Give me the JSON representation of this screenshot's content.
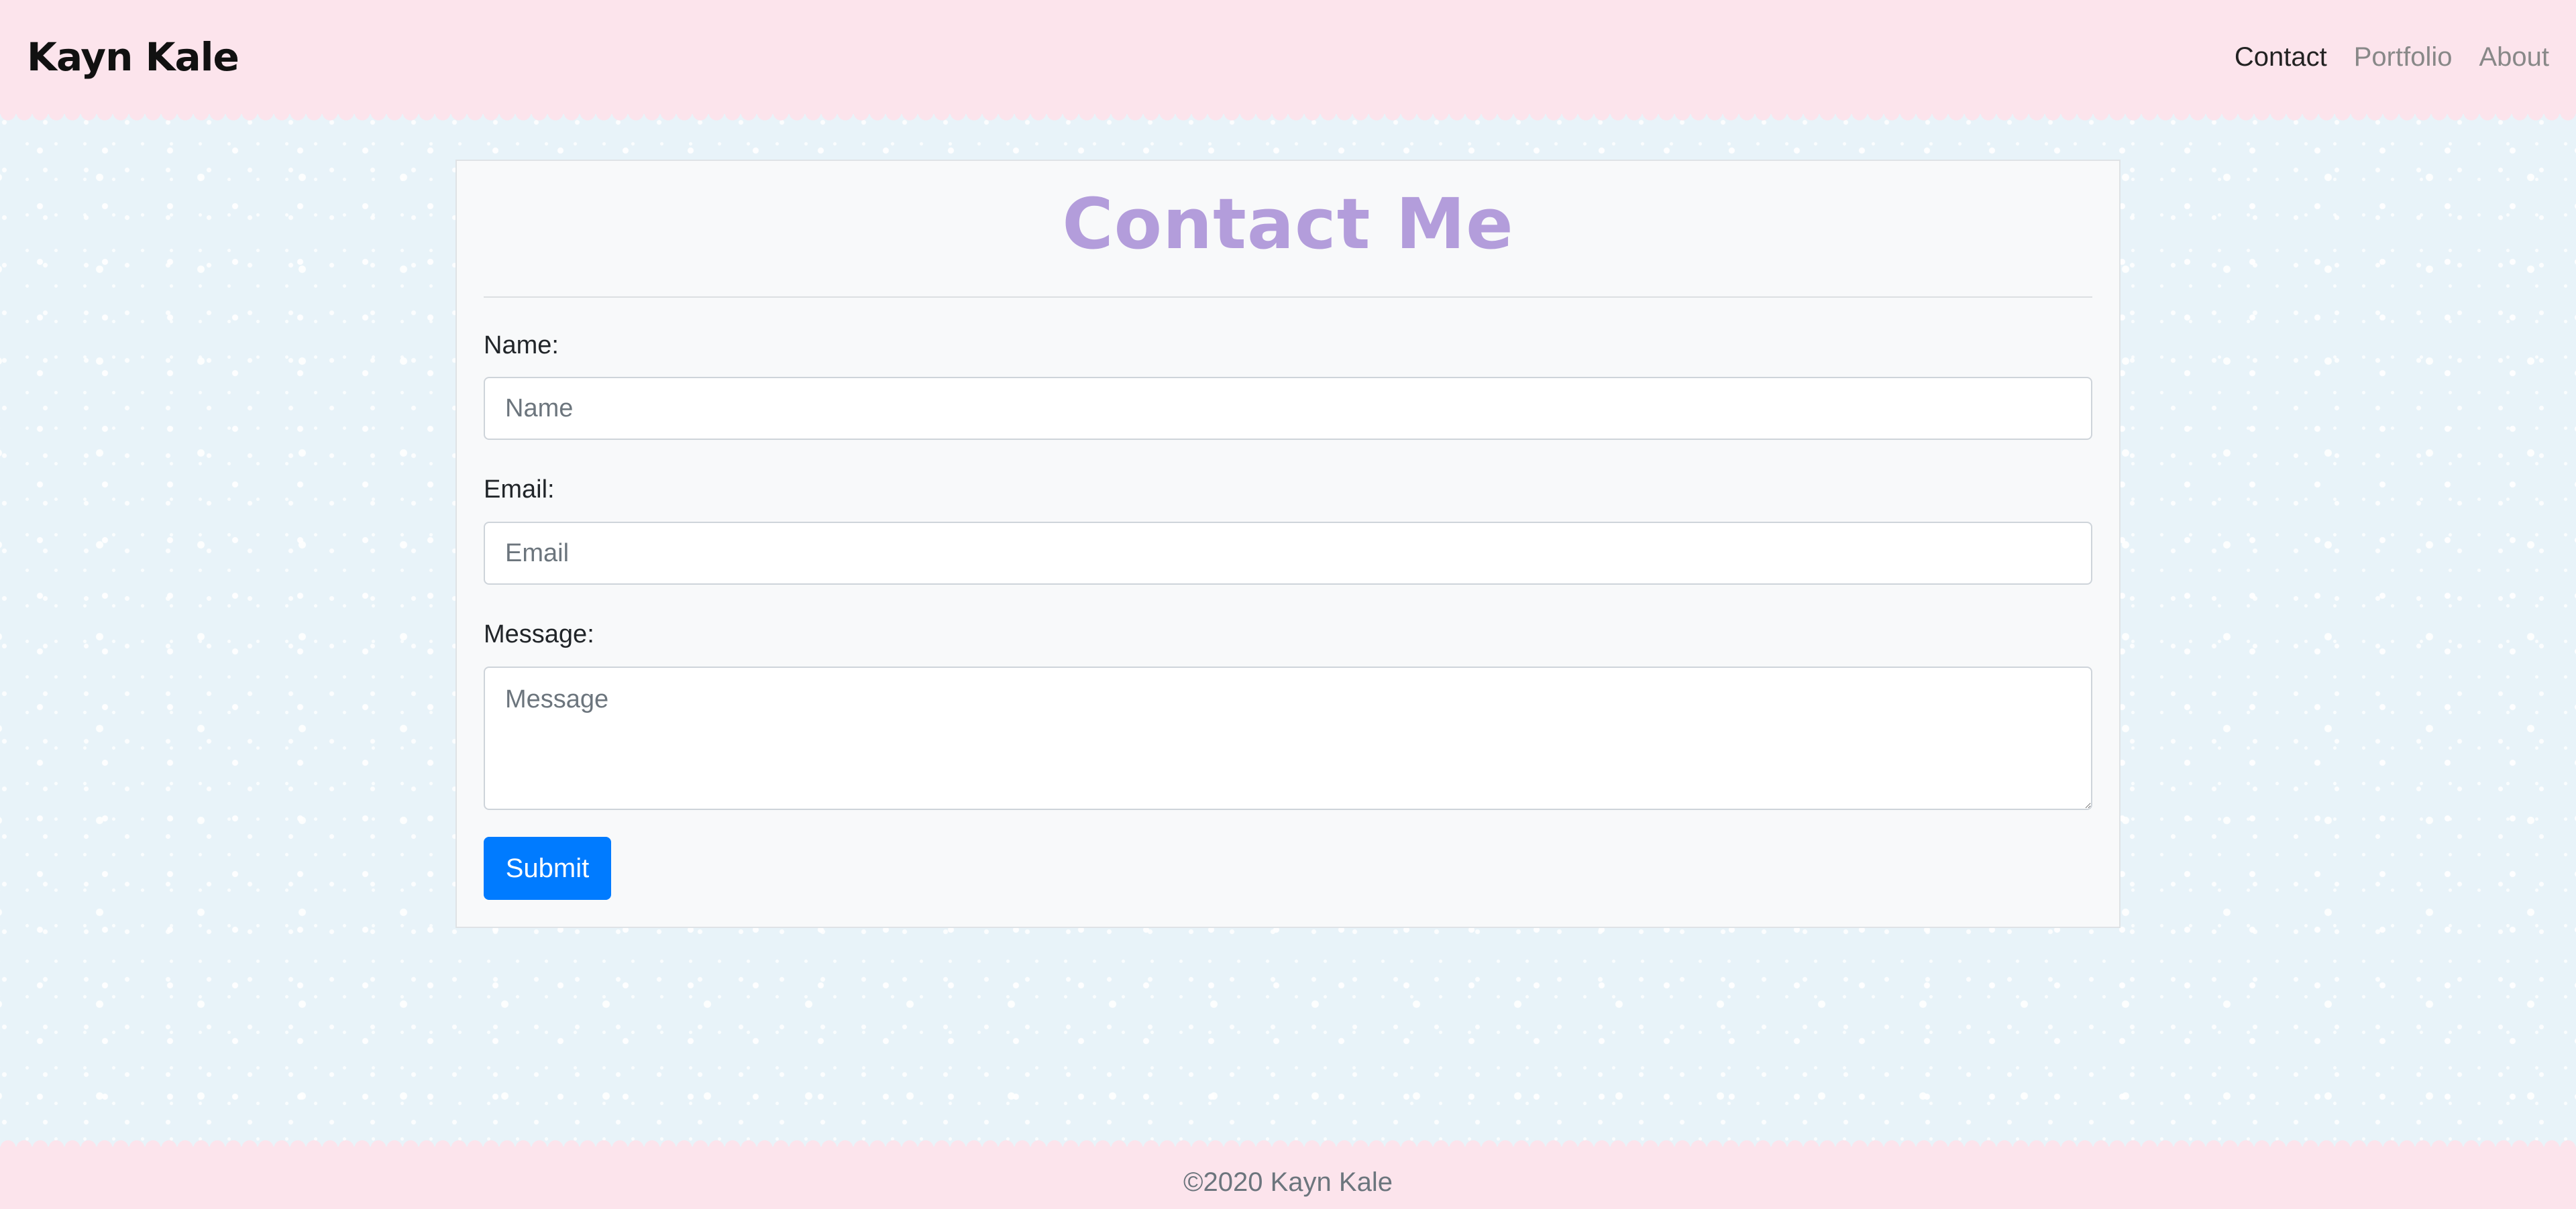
{
  "header": {
    "brand": "Kayn Kale",
    "nav": [
      {
        "label": "Contact",
        "active": true
      },
      {
        "label": "Portfolio",
        "active": false
      },
      {
        "label": "About",
        "active": false
      }
    ]
  },
  "contact_form": {
    "title": "Contact Me",
    "name": {
      "label": "Name:",
      "placeholder": "Name",
      "value": ""
    },
    "email": {
      "label": "Email:",
      "placeholder": "Email",
      "value": ""
    },
    "message": {
      "label": "Message:",
      "placeholder": "Message",
      "value": ""
    },
    "submit_label": "Submit"
  },
  "footer": {
    "copyright": "©2020 Kayn Kale"
  },
  "colors": {
    "header_bg": "#fce4ec",
    "page_bg": "#e8f3f9",
    "title": "#b39ddb",
    "submit_bg": "#007bff"
  }
}
